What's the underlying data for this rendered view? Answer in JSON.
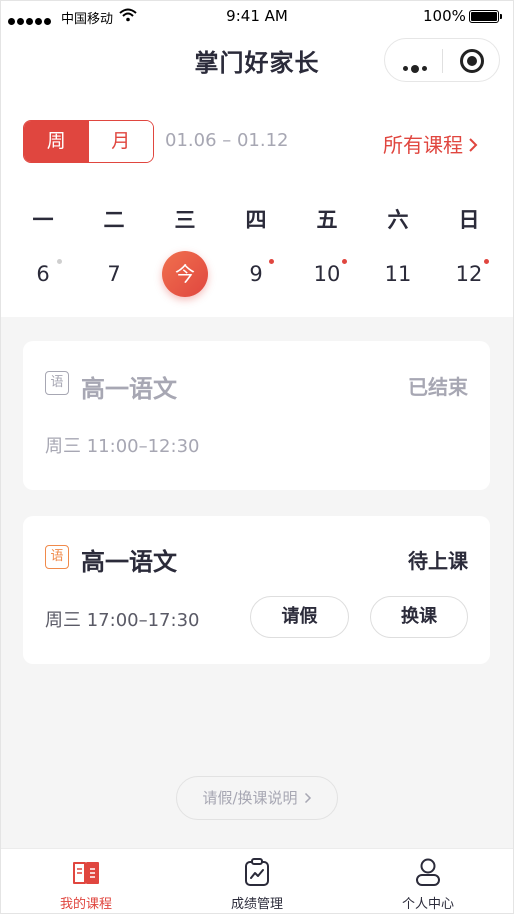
{
  "status_bar": {
    "carrier": "中国移动",
    "time": "9:41 AM",
    "battery": "100%"
  },
  "nav": {
    "title": "掌门好家长",
    "capsule_icons": [
      "more-icon",
      "close-mini-program-icon"
    ]
  },
  "view_toggle": {
    "options": [
      "周",
      "月"
    ],
    "selected": "周"
  },
  "date_range": "01.06 – 01.12",
  "all_courses_link": "所有课程",
  "calendar": {
    "weekdays": [
      "一",
      "二",
      "三",
      "四",
      "五",
      "六",
      "日"
    ],
    "dates": [
      "6",
      "7",
      "今",
      "9",
      "10",
      "11",
      "12"
    ],
    "today_index": 2,
    "today_label": "今",
    "gray_dot_indices": [
      0
    ],
    "red_dot_indices": [
      3,
      4,
      6
    ]
  },
  "courses": [
    {
      "subject_badge": "语",
      "title": "高一语文",
      "status": "已结束",
      "schedule": "周三 11:00–12:30"
    },
    {
      "subject_badge": "语",
      "title": "高一语文",
      "status": "待上课",
      "schedule": "周三 17:00–17:30",
      "actions": [
        "请假",
        "换课"
      ]
    }
  ],
  "help_link": "请假/换课说明",
  "tab_bar": [
    {
      "label": "我的课程",
      "icon": "book-icon",
      "active": true
    },
    {
      "label": "成绩管理",
      "icon": "clipboard-chart-icon",
      "active": false
    },
    {
      "label": "个人中心",
      "icon": "person-icon",
      "active": false
    }
  ],
  "colors": {
    "accent": "#e0463f",
    "badge_active": "#f08a4b",
    "text_primary": "#2b2b3a",
    "text_muted": "#a7a7b3"
  }
}
